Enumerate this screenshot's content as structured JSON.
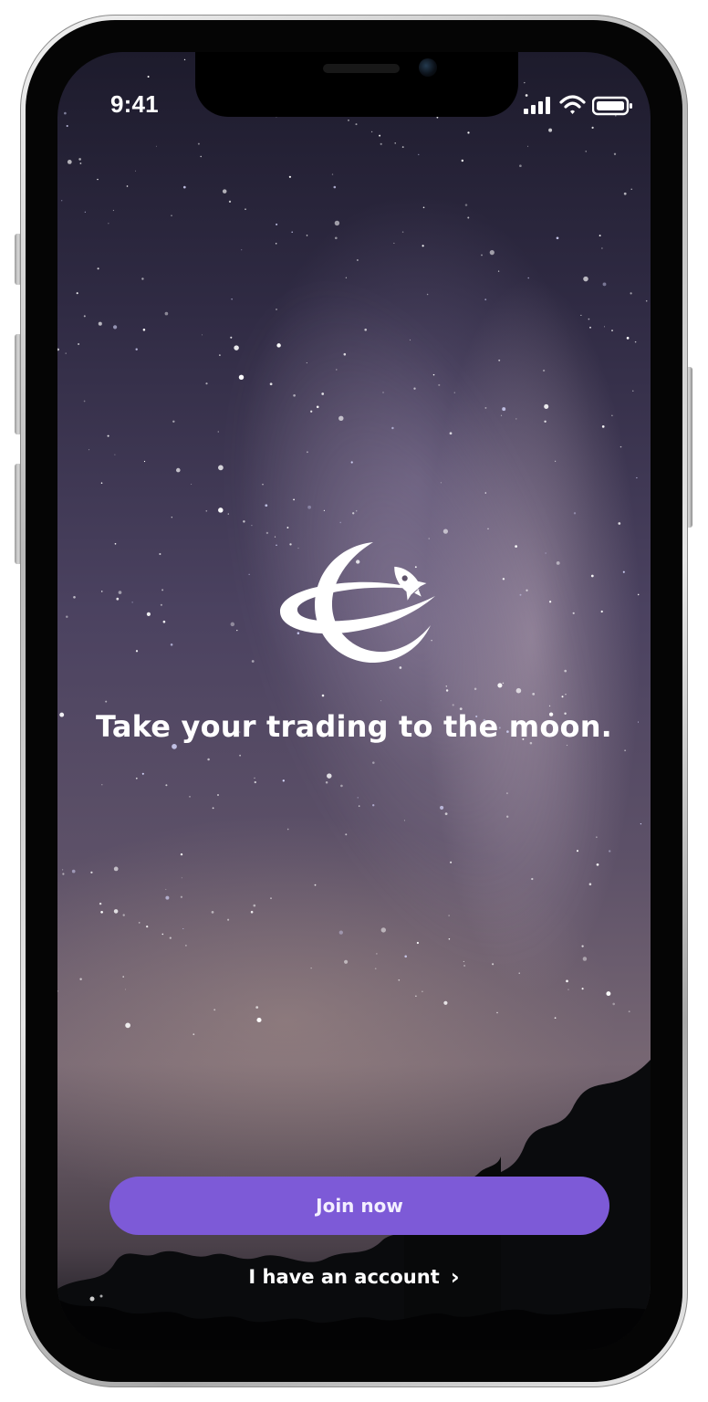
{
  "status_bar": {
    "time": "9:41",
    "icons": [
      "signal-icon",
      "wifi-icon",
      "battery-icon"
    ]
  },
  "brand": {
    "logo_icon": "planet-rocket-logo-icon"
  },
  "hero": {
    "headline": "Take your trading to the moon."
  },
  "actions": {
    "join_label": "Join now",
    "account_label": "I have an account",
    "account_icon": "chevron-right-icon"
  },
  "colors": {
    "primary_button": "#7d5ad7",
    "text": "#ffffff",
    "phone_bezel": "#050505"
  }
}
